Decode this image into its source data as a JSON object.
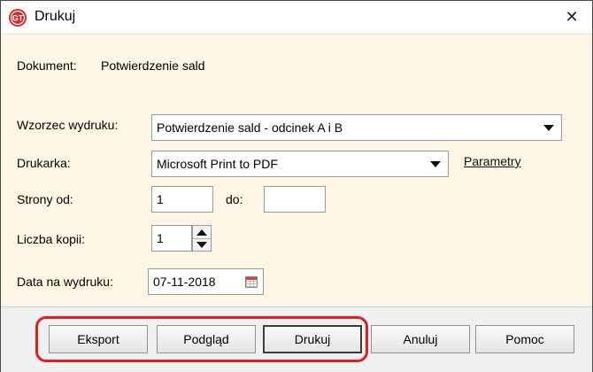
{
  "window": {
    "title": "Drukuj"
  },
  "document": {
    "label": "Dokument:",
    "value": "Potwierdzenie sald"
  },
  "template": {
    "label": "Wzorzec wydruku:",
    "value": "Potwierdzenie sald - odcinek A i B"
  },
  "printer": {
    "label": "Drukarka:",
    "value": "Microsoft Print to PDF",
    "params_link": "Parametry"
  },
  "pages": {
    "from_label": "Strony od:",
    "from_value": "1",
    "to_label": "do:",
    "to_value": ""
  },
  "copies": {
    "label": "Liczba kopii:",
    "value": "1"
  },
  "print_date": {
    "label": "Data na wydruku:",
    "value": "07-11-2018"
  },
  "buttons": {
    "export": "Eksport",
    "preview": "Podgląd",
    "print": "Drukuj",
    "cancel": "Anuluj",
    "help": "Pomoc"
  },
  "colors": {
    "dialog_bg": "#fdf6e4",
    "highlight": "#e0201c"
  }
}
